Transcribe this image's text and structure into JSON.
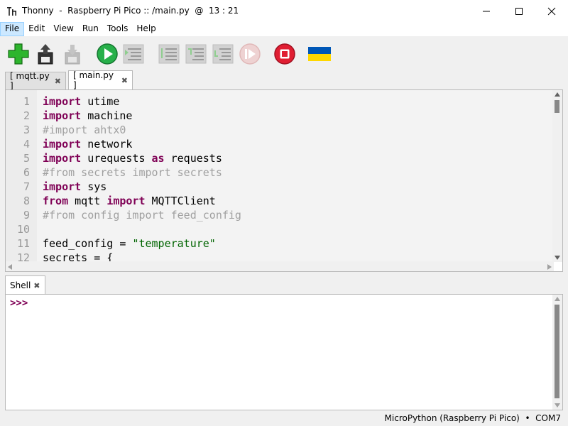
{
  "window": {
    "title": "Thonny  -  Raspberry Pi Pico :: /main.py  @  13 : 21",
    "app_icon": "thonny-icon",
    "controls": [
      "minimize-icon",
      "maximize-icon",
      "close-icon"
    ]
  },
  "menu": {
    "items": [
      {
        "label": "File",
        "active": true
      },
      {
        "label": "Edit"
      },
      {
        "label": "View"
      },
      {
        "label": "Run"
      },
      {
        "label": "Tools"
      },
      {
        "label": "Help"
      }
    ]
  },
  "toolbar": {
    "buttons": [
      {
        "icon": "new-file-icon",
        "color": "#22aa22"
      },
      {
        "icon": "open-file-icon"
      },
      {
        "icon": "save-file-icon"
      },
      {
        "icon": "run-icon",
        "color": "#22aa44"
      },
      {
        "icon": "debug-icon"
      },
      {
        "icon": "step-over-icon"
      },
      {
        "icon": "step-into-icon"
      },
      {
        "icon": "step-out-icon"
      },
      {
        "icon": "resume-icon"
      },
      {
        "icon": "stop-icon",
        "color": "#dd2233"
      },
      {
        "icon": "ukraine-flag-icon"
      }
    ]
  },
  "editor": {
    "tabs": [
      {
        "label": "[ mqtt.py ]",
        "selected": false
      },
      {
        "label": "[ main.py ]",
        "selected": true
      }
    ],
    "line_numbers": [
      "1",
      "2",
      "3",
      "4",
      "5",
      "6",
      "7",
      "8",
      "9",
      "10",
      "11",
      "12"
    ],
    "lines": [
      {
        "tokens": [
          {
            "t": "import",
            "c": "kw"
          },
          {
            "t": " utime"
          }
        ]
      },
      {
        "tokens": [
          {
            "t": "import",
            "c": "kw"
          },
          {
            "t": " machine"
          }
        ]
      },
      {
        "tokens": [
          {
            "t": "#import ahtx0",
            "c": "cm"
          }
        ]
      },
      {
        "tokens": [
          {
            "t": "import",
            "c": "kw"
          },
          {
            "t": " network"
          }
        ]
      },
      {
        "tokens": [
          {
            "t": "import",
            "c": "kw"
          },
          {
            "t": " urequests "
          },
          {
            "t": "as",
            "c": "kw"
          },
          {
            "t": " requests"
          }
        ]
      },
      {
        "tokens": [
          {
            "t": "#from secrets import secrets",
            "c": "cm"
          }
        ]
      },
      {
        "tokens": [
          {
            "t": "import",
            "c": "kw"
          },
          {
            "t": " sys"
          }
        ]
      },
      {
        "tokens": [
          {
            "t": "from",
            "c": "kw"
          },
          {
            "t": " mqtt "
          },
          {
            "t": "import",
            "c": "kw"
          },
          {
            "t": " MQTTClient"
          }
        ]
      },
      {
        "tokens": [
          {
            "t": "#from config import feed_config",
            "c": "cm"
          }
        ]
      },
      {
        "tokens": [
          {
            "t": ""
          }
        ]
      },
      {
        "tokens": [
          {
            "t": "feed_config = "
          },
          {
            "t": "\"temperature\"",
            "c": "str"
          }
        ]
      },
      {
        "tokens": [
          {
            "t": "secrets = {"
          }
        ]
      }
    ]
  },
  "shell": {
    "tab_label": "Shell",
    "prompt": ">>>"
  },
  "status": {
    "text": "MicroPython (Raspberry Pi Pico)  •  COM7"
  }
}
